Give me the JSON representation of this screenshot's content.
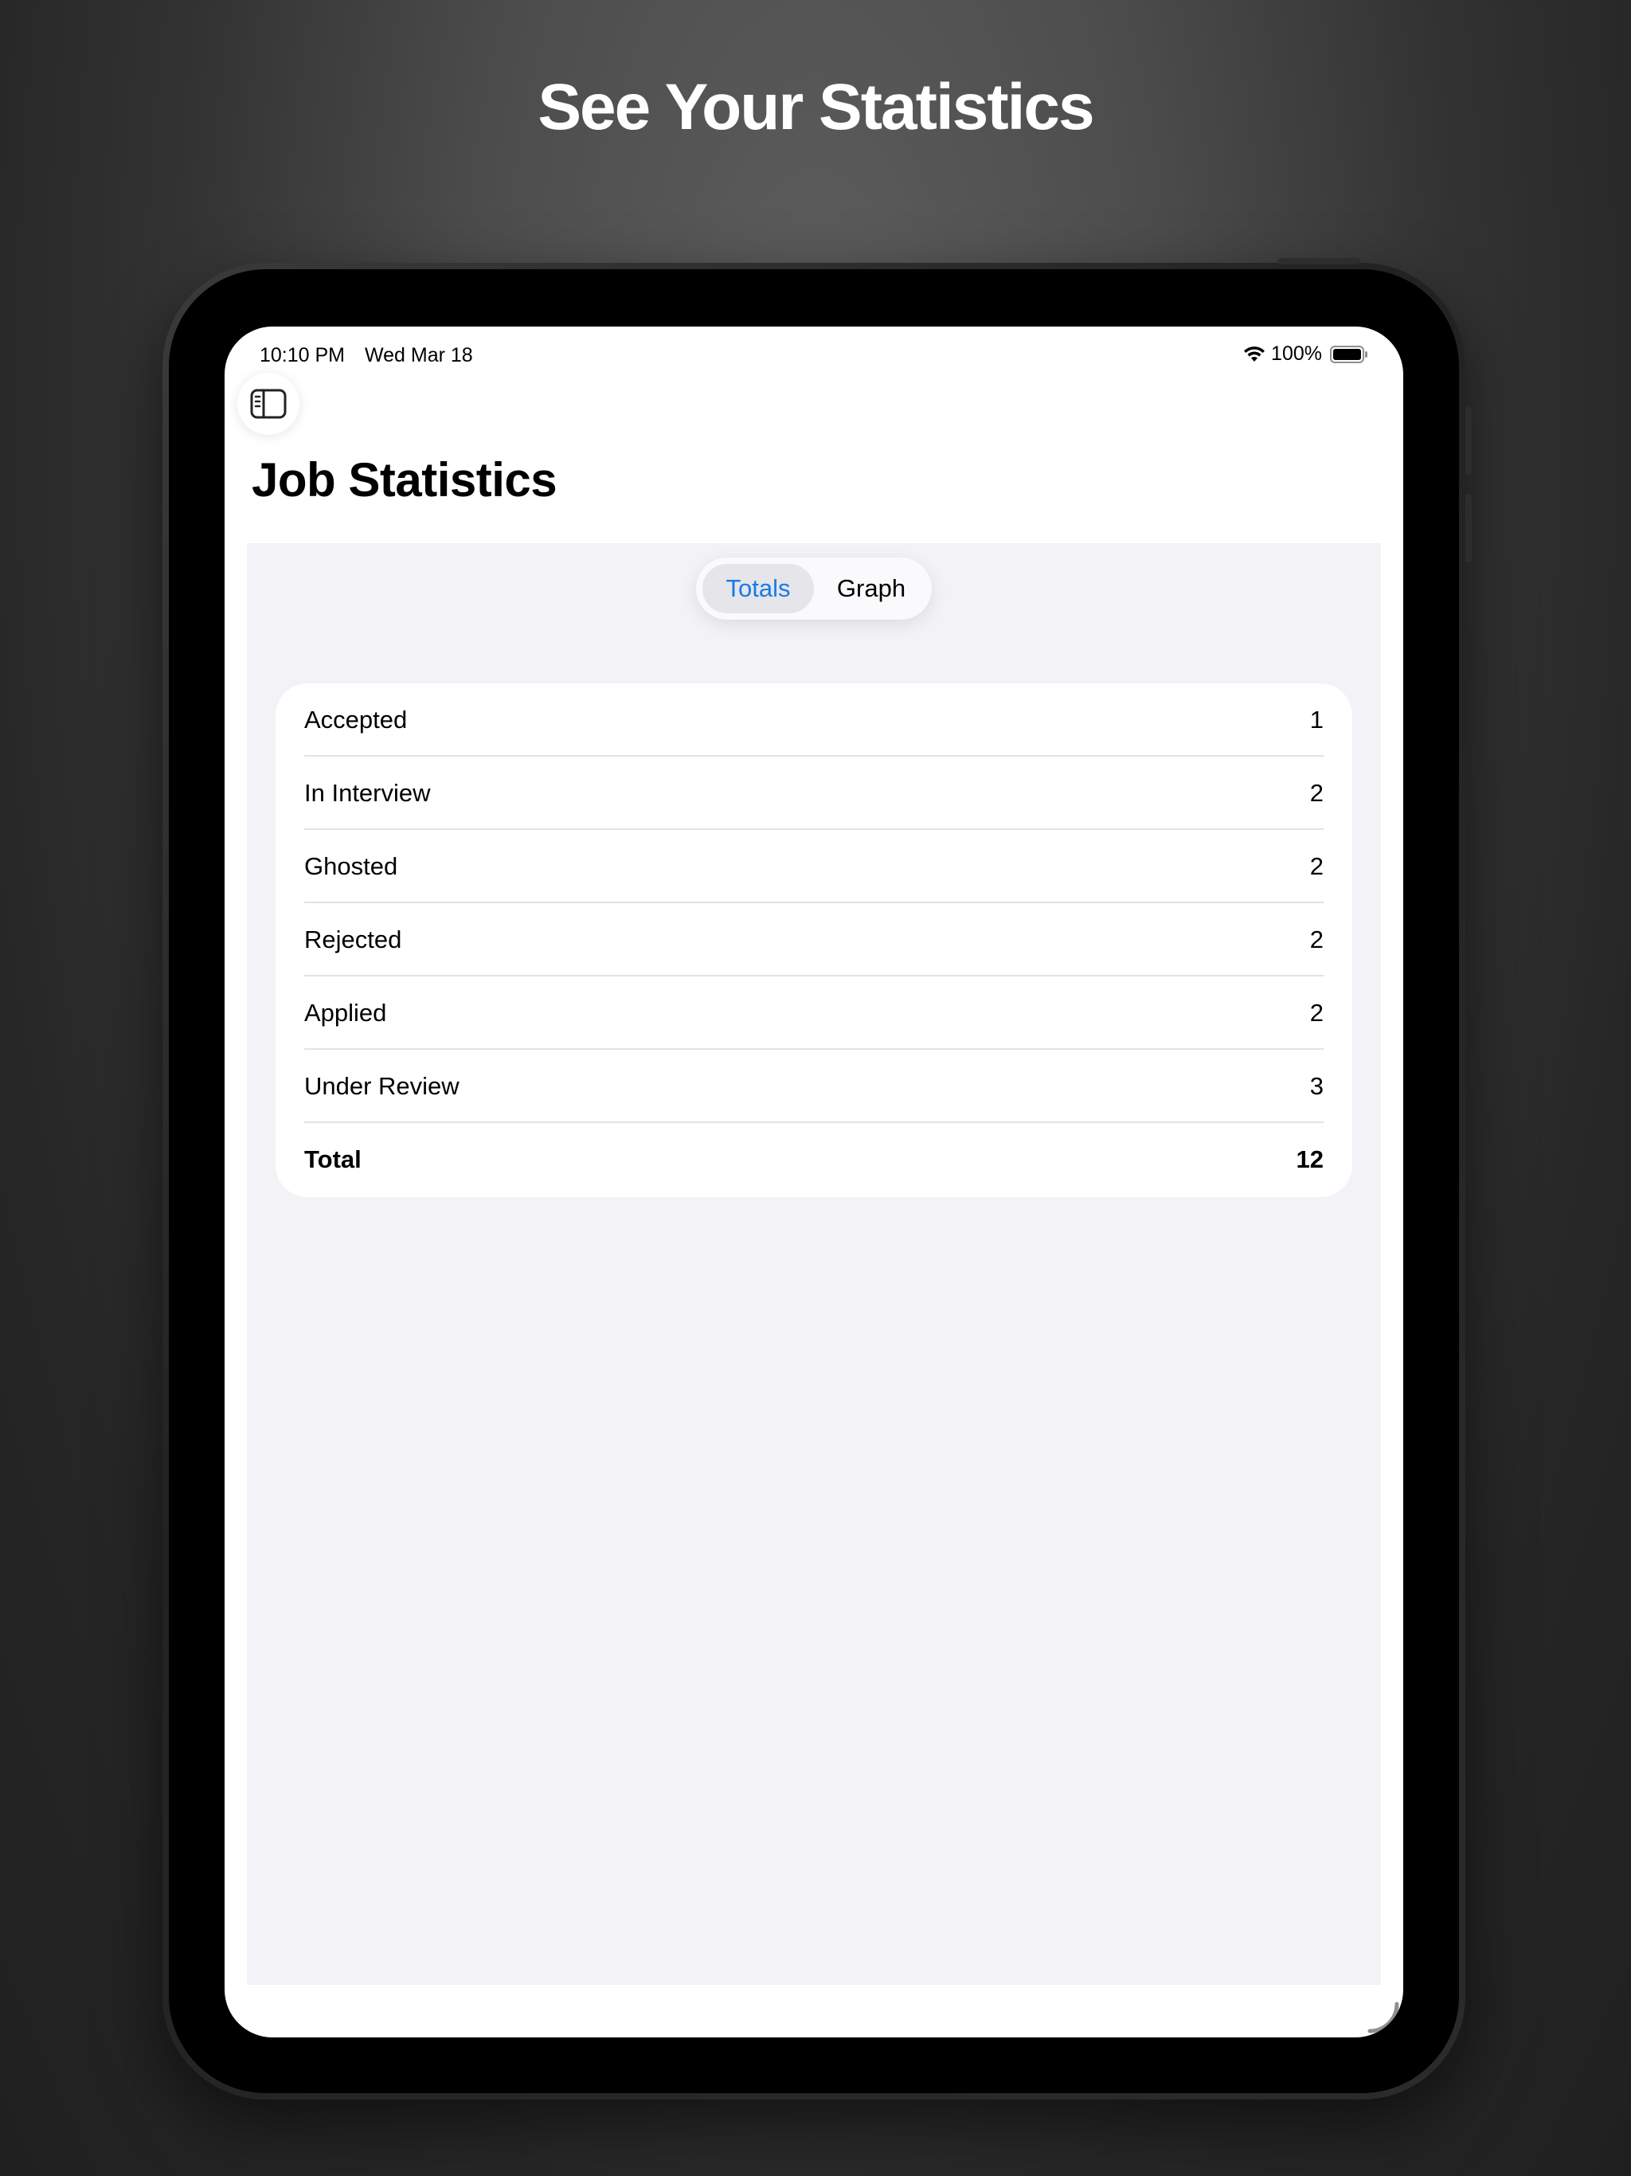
{
  "headline": "See Your Statistics",
  "status_bar": {
    "time": "10:10 PM",
    "date": "Wed Mar 18",
    "battery": "100%"
  },
  "icons": {
    "sidebar_toggle": "sidebar-icon",
    "wifi": "wifi-icon",
    "battery": "battery-icon"
  },
  "page": {
    "title": "Job Statistics"
  },
  "segments": {
    "totals": "Totals",
    "graph": "Graph",
    "selected": "Totals"
  },
  "stats": {
    "rows": [
      {
        "label": "Accepted",
        "value": "1"
      },
      {
        "label": "In Interview",
        "value": "2"
      },
      {
        "label": "Ghosted",
        "value": "2"
      },
      {
        "label": "Rejected",
        "value": "2"
      },
      {
        "label": "Applied",
        "value": "2"
      },
      {
        "label": "Under Review",
        "value": "3"
      }
    ],
    "total": {
      "label": "Total",
      "value": "12"
    }
  },
  "colors": {
    "accent": "#1a7ae6",
    "grouped_background": "#f2f2f7"
  }
}
